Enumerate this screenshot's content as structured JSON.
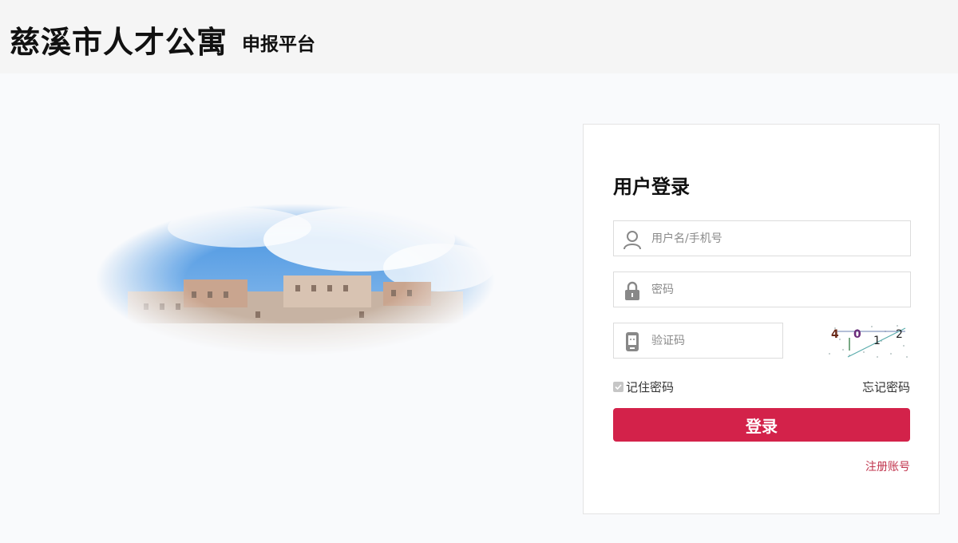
{
  "header": {
    "title": "慈溪市人才公寓",
    "subtitle": "申报平台"
  },
  "hero": {
    "image": "apartment-buildings-sky"
  },
  "login": {
    "title": "用户登录",
    "username_placeholder": "用户名/手机号",
    "password_placeholder": "密码",
    "captcha_placeholder": "验证码",
    "captcha_chars": [
      "4",
      "0",
      "1",
      "2"
    ],
    "remember_label": "记住密码",
    "forgot_label": "忘记密码",
    "submit_label": "登录",
    "register_label": "注册账号"
  },
  "colors": {
    "accent": "#d3224a",
    "link": "#c0344d"
  }
}
